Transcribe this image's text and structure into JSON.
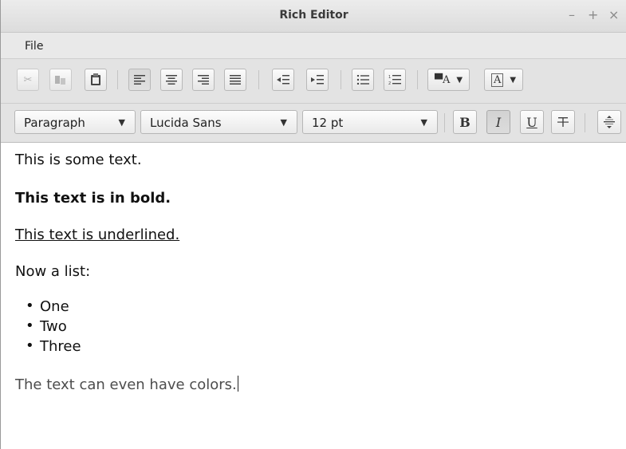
{
  "window": {
    "title": "Rich Editor",
    "controls": {
      "minimize": "–",
      "maximize": "+",
      "close": "×"
    }
  },
  "menubar": {
    "file": "File"
  },
  "toolbar_top": {
    "edit": [
      "scissors-icon",
      "copy-icon",
      "paste-icon"
    ],
    "align": [
      "align-left-icon",
      "align-center-icon",
      "align-right-icon",
      "align-justify-icon"
    ],
    "indent": [
      "outdent-icon",
      "indent-icon"
    ],
    "lists": [
      "bulleted-list-icon",
      "numbered-list-icon"
    ],
    "color_buttons": [
      "text-color-dropdown",
      "background-color-dropdown"
    ],
    "active_align": "align-left-icon"
  },
  "toolbar_format": {
    "paragraph_style": "Paragraph",
    "font_family": "Lucida Sans",
    "font_size": "12 pt",
    "bold_label": "B",
    "italic_label": "I",
    "underline_label": "U",
    "italic_active": true
  },
  "editor": {
    "line1": "This is some text.",
    "line2": "This text is in bold.",
    "line3": "This text is underlined.",
    "line4": "Now a list:",
    "list": [
      "One",
      "Two",
      "Three"
    ],
    "line5": "The text can even have colors."
  },
  "colors": {
    "toolbar_bg": "#e3e3e3",
    "titlebar_bg": "#e4e4e4",
    "colored_text": "#4d4d4d"
  }
}
